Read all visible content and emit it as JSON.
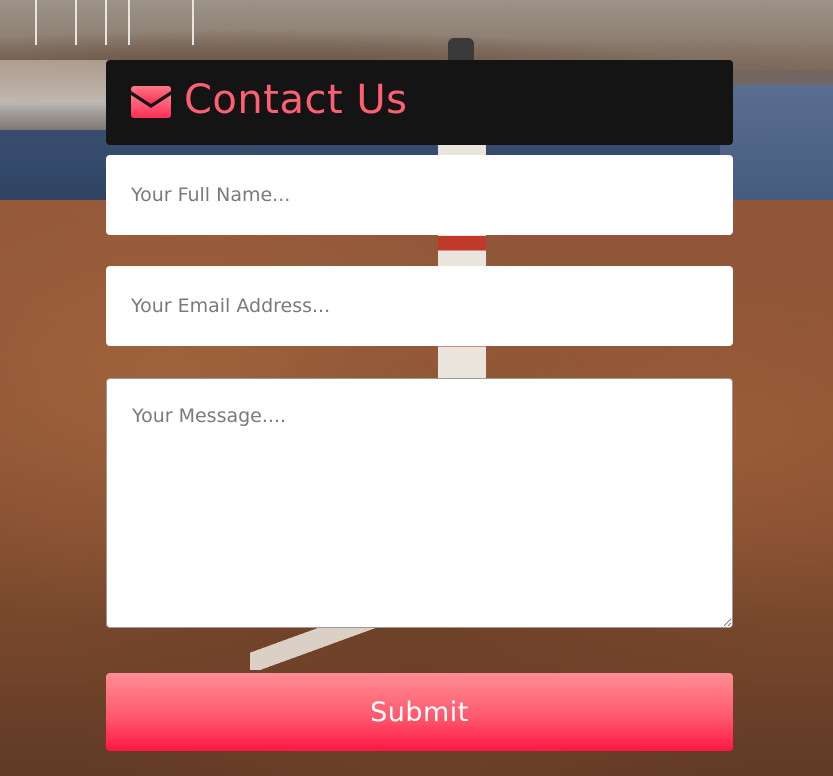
{
  "header": {
    "icon": "envelope-icon",
    "title": "Contact Us"
  },
  "form": {
    "name_placeholder": "Your Full Name...",
    "email_placeholder": "Your Email Address...",
    "message_placeholder": "Your Message....",
    "submit_label": "Submit"
  },
  "colors": {
    "accent": "#ff5f73",
    "header_bg": "#141414",
    "button_gradient_top": "#ff8e95",
    "button_gradient_bottom": "#ff1744"
  }
}
